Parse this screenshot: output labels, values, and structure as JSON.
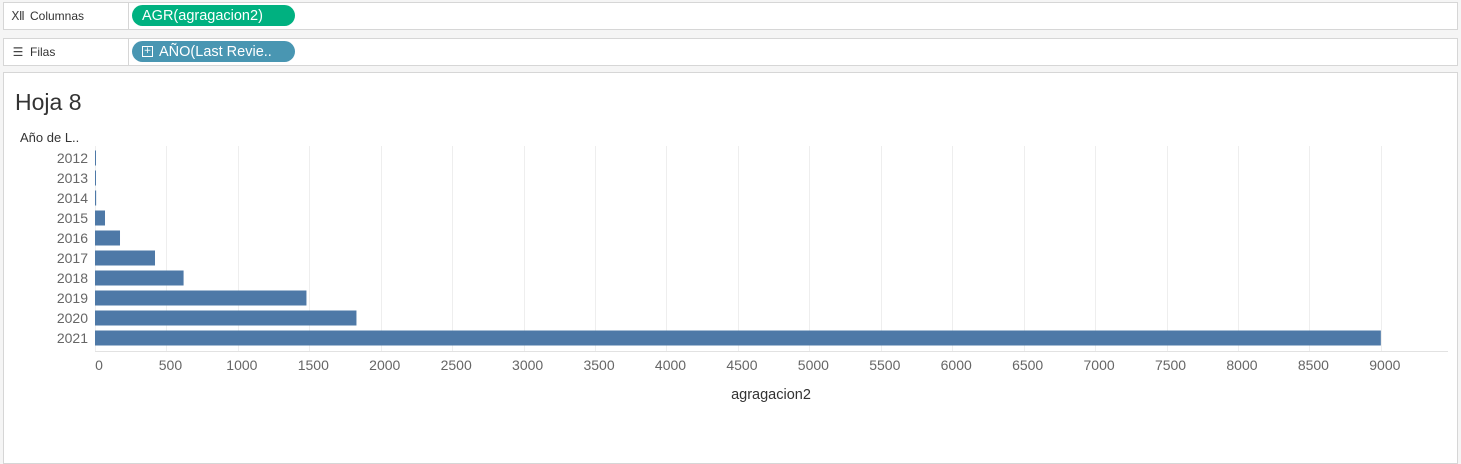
{
  "shelves": {
    "columns": {
      "label": "Columnas",
      "icon": "columns-icon",
      "pill": "AGR(agragacion2)",
      "pill_color": "#00b180"
    },
    "rows": {
      "label": "Filas",
      "icon": "rows-icon",
      "pill": "AÑO(Last Revie..",
      "pill_color": "#4996b2"
    }
  },
  "sheet": {
    "title": "Hoja 8"
  },
  "chart_data": {
    "type": "bar",
    "orientation": "horizontal",
    "row_header": "Año de L..",
    "categories": [
      "2012",
      "2013",
      "2014",
      "2015",
      "2016",
      "2017",
      "2018",
      "2019",
      "2020",
      "2021"
    ],
    "values": [
      1,
      2,
      8,
      70,
      175,
      420,
      620,
      1480,
      1830,
      9000
    ],
    "xlabel": "agragacion2",
    "xlim": [
      0,
      9470
    ],
    "xticks": [
      0,
      500,
      1000,
      1500,
      2000,
      2500,
      3000,
      3500,
      4000,
      4500,
      5000,
      5500,
      6000,
      6500,
      7000,
      7500,
      8000,
      8500,
      9000
    ],
    "bar_color": "#4e79a7",
    "grid": true
  }
}
